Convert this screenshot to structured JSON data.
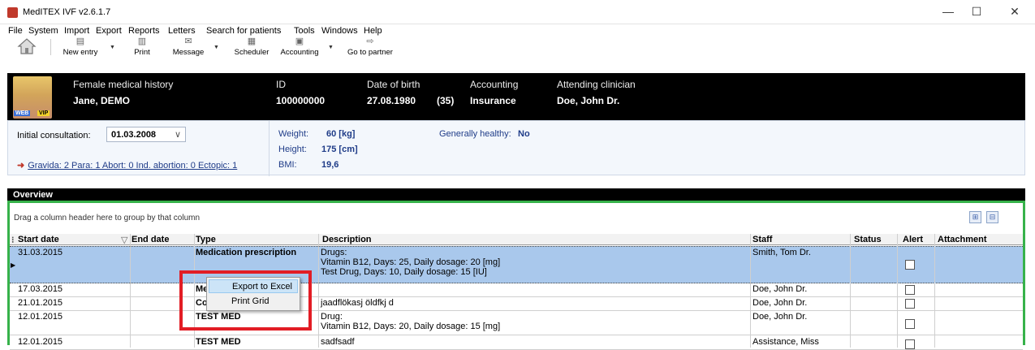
{
  "window": {
    "title": "MedITEX IVF v2.6.1.7",
    "minimize": "—",
    "maximize": "☐",
    "close": "✕"
  },
  "menu": [
    "File",
    "System",
    "Import",
    "Export",
    "Reports",
    "Letters",
    "Search for patients",
    "Tools",
    "Windows",
    "Help"
  ],
  "toolbar": {
    "new_entry": "New entry",
    "print": "Print",
    "message": "Message",
    "scheduler": "Scheduler",
    "accounting": "Accounting",
    "go_to_partner": "Go to partner"
  },
  "patient": {
    "type_label": "Female medical history",
    "name": "Jane, DEMO",
    "id_label": "ID",
    "id": "100000000",
    "dob_label": "Date of birth",
    "dob": "27.08.1980",
    "age": "(35)",
    "accounting_label": "Accounting",
    "accounting": "Insurance",
    "clinician_label": "Attending clinician",
    "clinician": "Doe, John Dr.",
    "badge_web": "WEB",
    "badge_vip": "VIP"
  },
  "vitals": {
    "initial_consultation_label": "Initial consultation:",
    "initial_consultation": "01.03.2008",
    "dropdown_glyph": "∨",
    "history_link": "Gravida: 2  Para: 1  Abort: 0  Ind. abortion: 0  Ectopic: 1",
    "weight_label": "Weight:",
    "weight": "60  [kg]",
    "height_label": "Height:",
    "height": "175  [cm]",
    "bmi_label": "BMI:",
    "bmi": "19,6",
    "healthy_label": "Generally healthy:",
    "healthy": "No"
  },
  "overview": {
    "title": "Overview",
    "group_hint": "Drag a column header here to group by that column",
    "expand": "⊞",
    "collapse": "⊟",
    "columns": [
      "Start date",
      "End date",
      "Type",
      "Description",
      "Staff",
      "Status",
      "Alert",
      "Attachment"
    ],
    "sort_glyph": "▽",
    "rows": [
      {
        "start": "31.03.2015",
        "end": "",
        "type": "Medication prescription",
        "desc": [
          "Drugs:",
          "Vitamin B12, Days: 25, Daily dosage: 20 [mg]",
          "Test Drug, Days: 10, Daily dosage: 15 [IU]"
        ],
        "staff": "Smith, Tom Dr."
      },
      {
        "start": "17.03.2015",
        "end": "",
        "type": "Me",
        "desc": [
          ""
        ],
        "staff": "Doe, John Dr."
      },
      {
        "start": "21.01.2015",
        "end": "",
        "type": "Co",
        "desc": [
          "jaadflökasj öldfkj d"
        ],
        "staff": "Doe, John Dr."
      },
      {
        "start": "12.01.2015",
        "end": "",
        "type": "TEST MED",
        "desc": [
          "Drug:",
          "Vitamin B12, Days: 20, Daily dosage: 15 [mg]"
        ],
        "staff": "Doe, John Dr."
      },
      {
        "start": "12.01.2015",
        "end": "",
        "type": "TEST MED",
        "desc": [
          "sadfsadf"
        ],
        "staff": "Assistance, Miss"
      }
    ]
  },
  "context_menu": {
    "export_excel": "Export to Excel",
    "print_grid": "Print Grid"
  },
  "colors": {
    "accent_green": "#36b24a",
    "selected_row": "#a9c8ec",
    "highlight_red": "#e21d25"
  }
}
